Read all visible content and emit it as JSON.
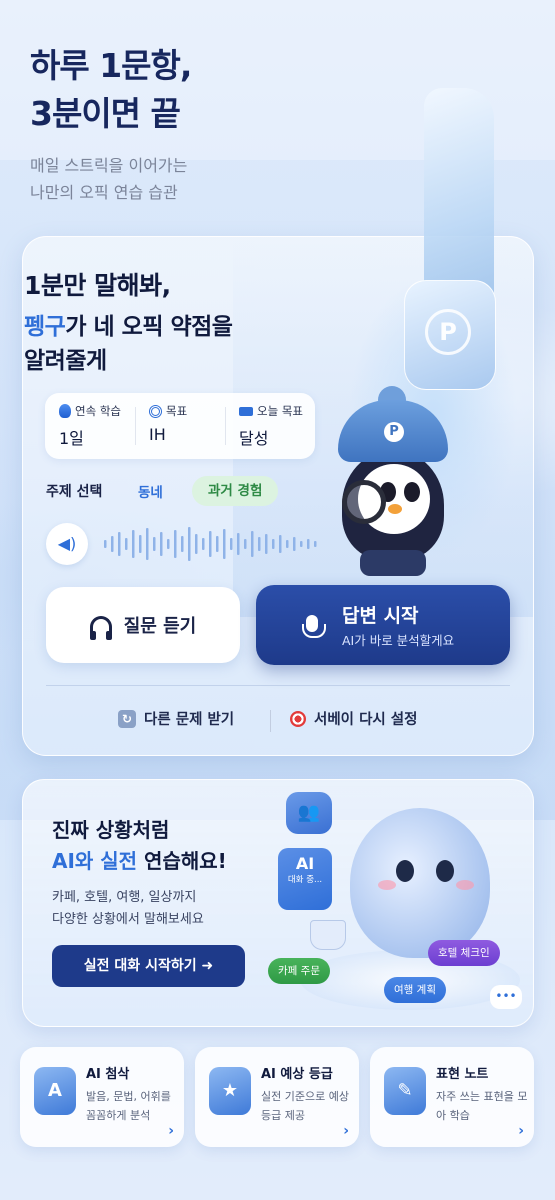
{
  "hero": {
    "title_line1": "하루 1문항,",
    "title_line2": "3분이면 끝",
    "sub_line1": "매일 스트릭을 이어가는",
    "sub_line2": "나만의 오픽 연습 습관"
  },
  "practice_card": {
    "title_line1": "1분만 말해봐,",
    "title_highlight": "펭구",
    "title_line2_rest": "가 네 오픽 약점을",
    "title_line3": "알려줄게",
    "stats": [
      {
        "icon": "fire-icon",
        "label": "연속 학습",
        "value": "1일"
      },
      {
        "icon": "target-icon",
        "label": "목표",
        "value": "IH"
      },
      {
        "icon": "ticket-icon",
        "label": "오늘 목표",
        "value": "달성"
      }
    ],
    "topic_label": "주제 선택",
    "topic_chip_1": "동네",
    "topic_chip_2": "과거 경험",
    "listen_button": "질문 듣기",
    "answer_button": "답변 시작",
    "answer_button_sub": "AI가 바로 분석할게요",
    "refresh_link": "다른 문제 받기",
    "survey_link": "서베이 다시 설정",
    "mascot_hat_letter": "P"
  },
  "conversation_card": {
    "title_line1": "진짜 상황처럼",
    "title_highlight": "AI와 실전",
    "title_line2_rest": " 연습해요!",
    "desc_line1": "카페, 호텔, 여행, 일상까지",
    "desc_line2": "다양한 상황에서 말해보세요",
    "cta": "실전 대화 시작하기 ➜",
    "ai_bubble_title": "AI",
    "ai_bubble_sub": "대화 중...",
    "tags": [
      "카페 주문",
      "호텔 체크인",
      "여행 계획"
    ]
  },
  "features": [
    {
      "icon": "a-icon",
      "glyph": "A",
      "title": "AI 첨삭",
      "desc": "발음, 문법, 어휘를 꼼꼼하게 분석"
    },
    {
      "icon": "star-icon",
      "glyph": "★",
      "title": "AI 예상 등급",
      "desc": "실전 기준으로 예상 등급 제공"
    },
    {
      "icon": "notebook-icon",
      "glyph": "✎",
      "title": "표현 노트",
      "desc": "자주 쓰는 표현을 모아 학습"
    }
  ],
  "colors": {
    "primary": "#1e3a8a",
    "accent": "#2f6fd8",
    "green_chip": "#dcf3e0",
    "text_dark": "#101a3d"
  }
}
